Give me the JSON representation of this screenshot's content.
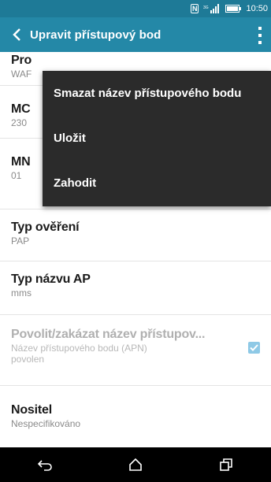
{
  "status_bar": {
    "nfc_label": "N",
    "time": "10:50"
  },
  "action_bar": {
    "title": "Upravit přístupový bod"
  },
  "list": {
    "items": [
      {
        "title": "Pro",
        "summary": "WAF"
      },
      {
        "title": "MC",
        "summary": "230"
      },
      {
        "title": "MN",
        "summary": "01"
      },
      {
        "title": "Typ ověření",
        "summary": "PAP"
      },
      {
        "title": "Typ názvu AP",
        "summary": "mms"
      },
      {
        "title": "Povolit/zakázat název přístupov...",
        "summary_line1": "Název přístupového bodu (APN)",
        "summary_line2": "povolen",
        "checked": true
      },
      {
        "title": "Nositel",
        "summary": "Nespecifikováno"
      }
    ]
  },
  "menu": {
    "items": [
      {
        "label": "Smazat název přístupového bodu"
      },
      {
        "label": "Uložit"
      },
      {
        "label": "Zahodit"
      }
    ]
  },
  "colors": {
    "status_bar": "#1e7a97",
    "action_bar": "#2488a7",
    "menu_bg": "#2b2b2b",
    "checkbox": "#8ec9e6"
  }
}
